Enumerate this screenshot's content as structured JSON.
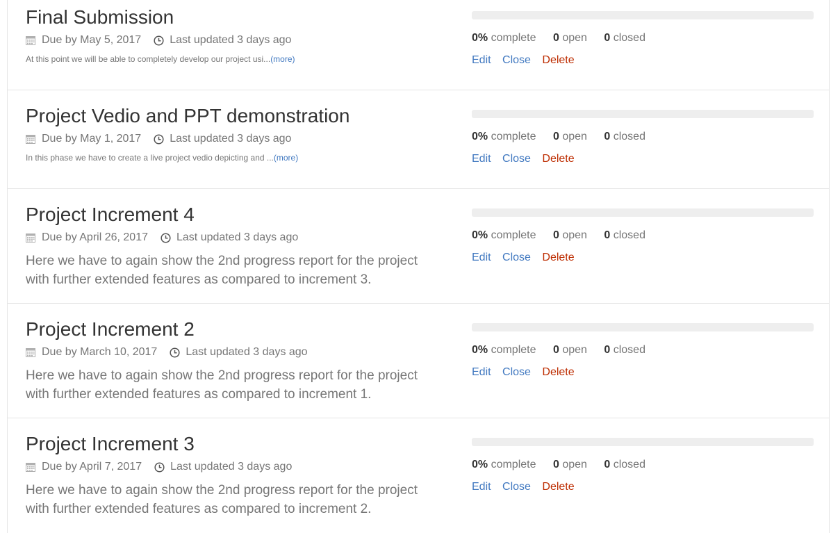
{
  "milestones": [
    {
      "title": "Final Submission",
      "due": "Due by May 5, 2017",
      "updated": "Last updated 3 days ago",
      "description": "At this point we will be able to completely develop our project usi...",
      "more": "(more)",
      "description_style": "small",
      "progress_percent": 0,
      "percent_value": "0%",
      "percent_label": "complete",
      "open_value": "0",
      "open_label": "open",
      "closed_value": "0",
      "closed_label": "closed",
      "edit": "Edit",
      "close": "Close",
      "delete": "Delete"
    },
    {
      "title": "Project Vedio and PPT demonstration",
      "due": "Due by May 1, 2017",
      "updated": "Last updated 3 days ago",
      "description": "In this phase we have to create a live project vedio depicting and ...",
      "more": "(more)",
      "description_style": "small",
      "progress_percent": 0,
      "percent_value": "0%",
      "percent_label": "complete",
      "open_value": "0",
      "open_label": "open",
      "closed_value": "0",
      "closed_label": "closed",
      "edit": "Edit",
      "close": "Close",
      "delete": "Delete"
    },
    {
      "title": "Project Increment 4",
      "due": "Due by April 26, 2017",
      "updated": "Last updated 3 days ago",
      "description": "Here we have to again show the 2nd progress report for the project with further extended features as compared to increment 3.",
      "description_style": "large",
      "progress_percent": 0,
      "percent_value": "0%",
      "percent_label": "complete",
      "open_value": "0",
      "open_label": "open",
      "closed_value": "0",
      "closed_label": "closed",
      "edit": "Edit",
      "close": "Close",
      "delete": "Delete"
    },
    {
      "title": "Project Increment 2",
      "due": "Due by March 10, 2017",
      "updated": "Last updated 3 days ago",
      "description": "Here we have to again show the 2nd progress report for the project with further extended features as compared to increment 1.",
      "description_style": "large",
      "progress_percent": 0,
      "percent_value": "0%",
      "percent_label": "complete",
      "open_value": "0",
      "open_label": "open",
      "closed_value": "0",
      "closed_label": "closed",
      "edit": "Edit",
      "close": "Close",
      "delete": "Delete"
    },
    {
      "title": "Project Increment 3",
      "due": "Due by April 7, 2017",
      "updated": "Last updated 3 days ago",
      "description": "Here we have to again show the 2nd progress report for the project with further extended features as compared to increment 2.",
      "description_style": "large",
      "progress_percent": 0,
      "percent_value": "0%",
      "percent_label": "complete",
      "open_value": "0",
      "open_label": "open",
      "closed_value": "0",
      "closed_label": "closed",
      "edit": "Edit",
      "close": "Close",
      "delete": "Delete"
    }
  ],
  "icons": {
    "due": "calendar-icon",
    "updated": "clock-icon"
  },
  "colors": {
    "link": "#4078c0",
    "delete": "#bd2c00",
    "progress_track": "#eeeeee",
    "progress_fill": "#6cc644"
  }
}
